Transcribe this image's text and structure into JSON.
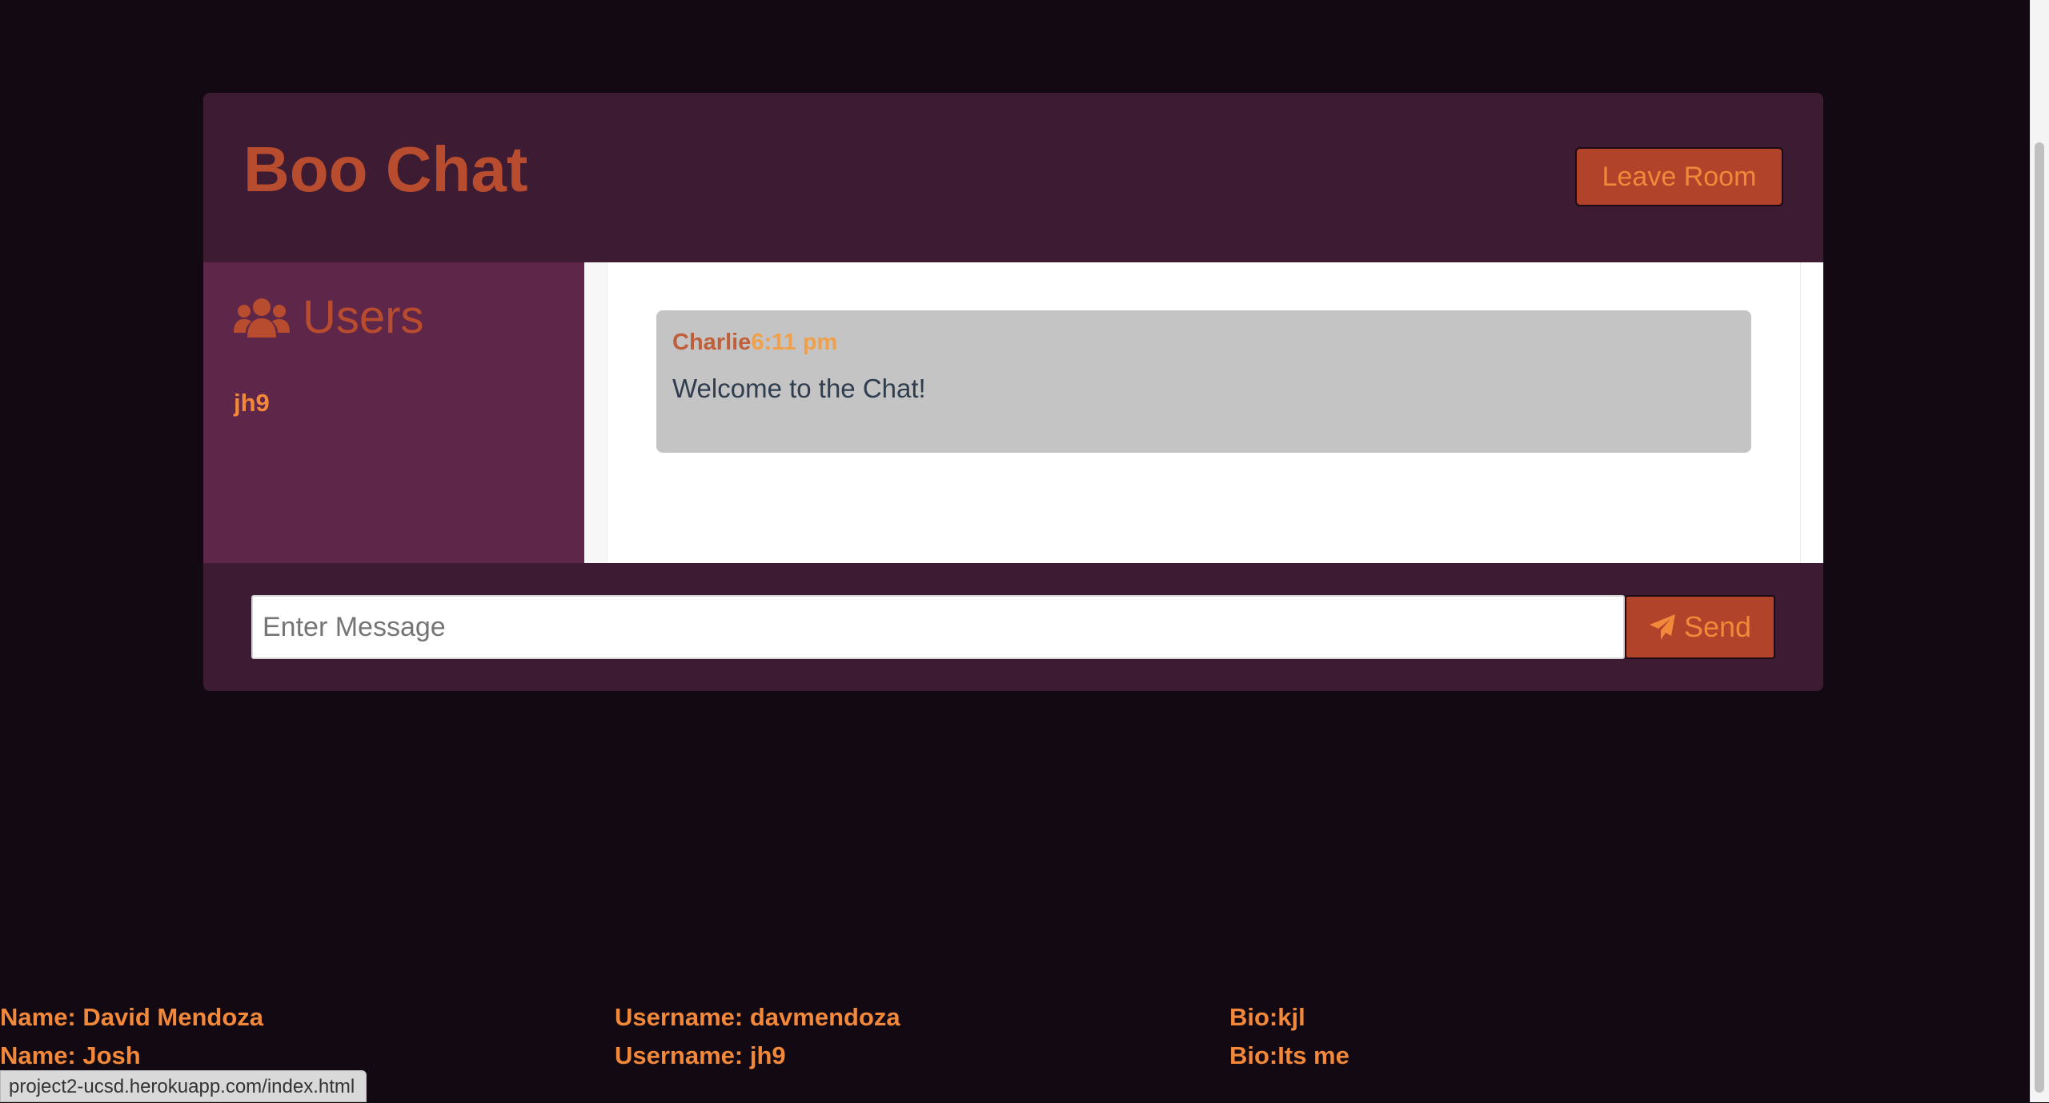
{
  "header": {
    "title": "Boo Chat",
    "leave_button_label": "Leave Room"
  },
  "sidebar": {
    "heading": "Users",
    "heading_icon": "users-icon",
    "users": [
      "jh9"
    ]
  },
  "messages": [
    {
      "author": "Charlie",
      "time": "6:11 pm",
      "text": "Welcome to the Chat!"
    }
  ],
  "composer": {
    "placeholder": "Enter Message",
    "value": "",
    "send_label": "Send",
    "send_icon": "paper-plane-icon"
  },
  "user_records": [
    {
      "name": "Name: David Mendoza",
      "username": "Username: davmendoza",
      "bio": "Bio:kjl"
    },
    {
      "name": "Name: Josh",
      "username": "Username: jh9",
      "bio": "Bio:Its me"
    }
  ],
  "status_bar": {
    "url": "project2-ucsd.herokuapp.com/index.html"
  },
  "colors": {
    "page_background": "#120912",
    "header_background": "#3d1b32",
    "sidebar_background": "#5e2749",
    "accent_orange": "#f2883a",
    "title_rust": "#b84c2e",
    "button_background": "#b0432a",
    "message_background": "#c4c4c4"
  }
}
